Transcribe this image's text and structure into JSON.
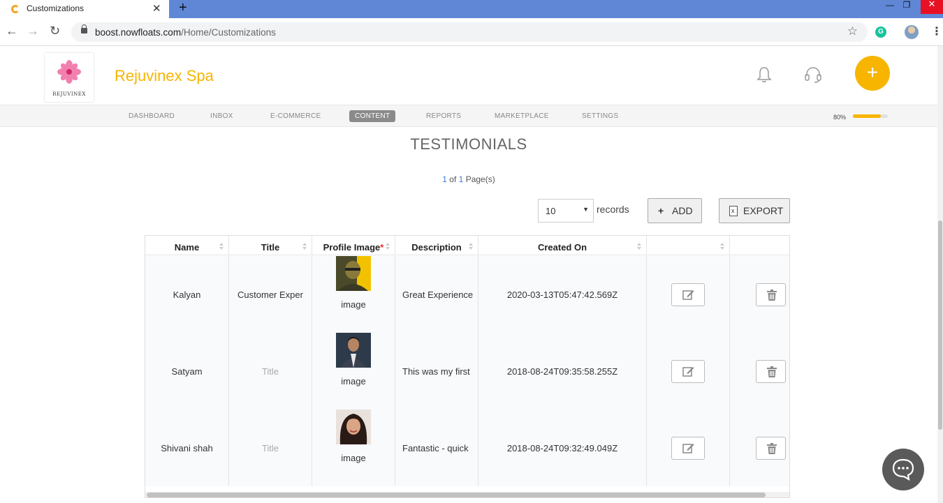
{
  "browser": {
    "tab_title": "Customizations",
    "url_host": "boost.nowfloats.com",
    "url_path": "/Home/Customizations"
  },
  "header": {
    "logo_text": "REJUVINEX",
    "brand": "Rejuvinex Spa",
    "add_symbol": "+"
  },
  "nav": {
    "items": [
      "DASHBOARD",
      "INBOX",
      "E-COMMERCE",
      "CONTENT",
      "REPORTS",
      "MARKETPLACE",
      "SETTINGS"
    ],
    "active": "CONTENT",
    "progress_label": "80%",
    "progress_value": 0.8
  },
  "main": {
    "title": "TESTIMONIALS",
    "pager": {
      "current": "1",
      "of": "of",
      "total": "1",
      "suffix": "Page(s)"
    },
    "records_value": "10",
    "records_label": "records",
    "add_label": "ADD",
    "export_label": "EXPORT"
  },
  "table": {
    "columns": [
      "Name",
      "Title",
      "Profile Image",
      "Description",
      "Created On",
      "",
      ""
    ],
    "required_mark": "*",
    "rows": [
      {
        "name": "Kalyan",
        "title": "Customer Exper",
        "title_is_placeholder": false,
        "image_label": "image",
        "description": "Great Experience",
        "created_on": "2020-03-13T05:47:42.569Z"
      },
      {
        "name": "Satyam",
        "title": "Title",
        "title_is_placeholder": true,
        "image_label": "image",
        "description": "This was my first",
        "created_on": "2018-08-24T09:35:58.255Z"
      },
      {
        "name": "Shivani shah",
        "title": "Title",
        "title_is_placeholder": true,
        "image_label": "image",
        "description": "Fantastic - quick",
        "created_on": "2018-08-24T09:32:49.049Z"
      }
    ]
  },
  "colors": {
    "accent": "#f7b500",
    "tabbar": "#5f87d6",
    "required": "#e82b2b"
  }
}
